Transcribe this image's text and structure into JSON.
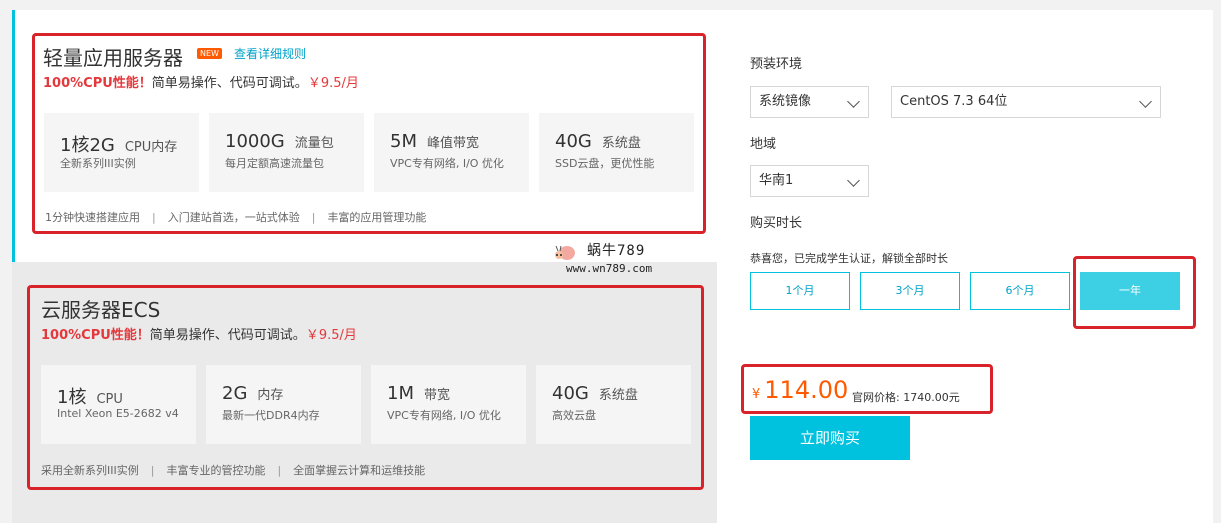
{
  "lightweight": {
    "title": "轻量应用服务器",
    "badge": "NEW",
    "rules_link": "查看详细规则",
    "promo_highlight": "100%CPU性能！",
    "promo_text": "简单易操作、代码可调试。",
    "promo_price": "￥9.5/月",
    "specs": [
      {
        "value": "1核2G",
        "unit": "CPU内存",
        "sub": "全新系列III实例"
      },
      {
        "value": "1000G",
        "unit": "流量包",
        "sub": "每月定额高速流量包"
      },
      {
        "value": "5M",
        "unit": "峰值带宽",
        "sub": "VPC专有网络, I/O 优化"
      },
      {
        "value": "40G",
        "unit": "系统盘",
        "sub": "SSD云盘，更优性能"
      }
    ],
    "features": [
      "1分钟快速搭建应用",
      "入门建站首选，一站式体验",
      "丰富的应用管理功能"
    ]
  },
  "ecs": {
    "title": "云服务器ECS",
    "promo_highlight": "100%CPU性能！",
    "promo_text": "简单易操作、代码可调试。",
    "promo_price": "￥9.5/月",
    "specs": [
      {
        "value": "1核",
        "unit": "CPU",
        "sub": "Intel Xeon E5-2682 v4"
      },
      {
        "value": "2G",
        "unit": "内存",
        "sub": "最新一代DDR4内存"
      },
      {
        "value": "1M",
        "unit": "带宽",
        "sub": "VPC专有网络, I/O 优化"
      },
      {
        "value": "40G",
        "unit": "系统盘",
        "sub": "高效云盘"
      }
    ],
    "features": [
      "采用全新系列III实例",
      "丰富专业的管控功能",
      "全面掌握云计算和运维技能"
    ]
  },
  "config": {
    "env_label": "预装环境",
    "image_type": "系统镜像",
    "os": "CentOS 7.3 64位",
    "region_label": "地域",
    "region": "华南1",
    "duration_label": "购买时长",
    "student_note": "恭喜您，已完成学生认证，解锁全部时长",
    "durations": [
      "1个月",
      "3个月",
      "6个月",
      "一年"
    ],
    "selected_duration": "一年",
    "currency": "¥",
    "price": "114.00",
    "orig_price": "官网价格: 1740.00元",
    "buy_label": "立即购买"
  },
  "watermark": {
    "text1": "蜗牛789",
    "text2": "www.wn789.com"
  },
  "colors": {
    "accent": "#00c1de",
    "highlight_red": "#d8232a",
    "price_orange": "#ff5a00"
  }
}
